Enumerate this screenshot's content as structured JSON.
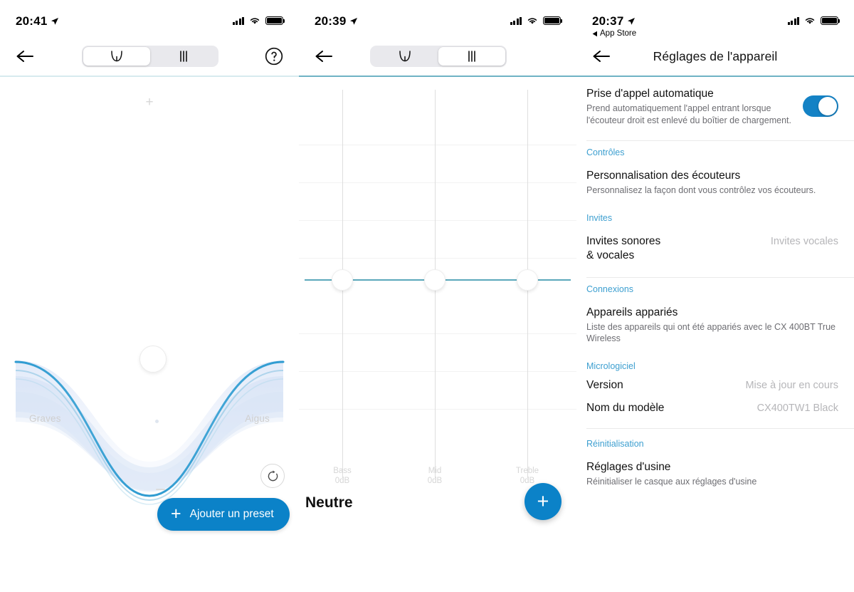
{
  "panel_eq_curve": {
    "status": {
      "time": "20:41",
      "location_icon": "location-arrow-icon"
    },
    "nav": {
      "back_icon": "back-arrow-icon",
      "help_icon": "help-question-icon",
      "segments": [
        {
          "id": "curve",
          "icon": "eq-curve-icon",
          "selected": true
        },
        {
          "id": "sliders",
          "icon": "eq-sliders-icon",
          "selected": false
        }
      ]
    },
    "add_hint": "+",
    "labels": {
      "bass": "Graves",
      "treble": "Aigus"
    },
    "reset_icon": "reset-circular-arrow-icon",
    "add_preset_button": {
      "plus": "+",
      "label": "Ajouter un preset"
    }
  },
  "panel_eq_sliders": {
    "status": {
      "time": "20:39",
      "location_icon": "location-arrow-icon"
    },
    "nav": {
      "back_icon": "back-arrow-icon",
      "segments": [
        {
          "id": "curve",
          "icon": "eq-curve-icon",
          "selected": false
        },
        {
          "id": "sliders",
          "icon": "eq-sliders-icon",
          "selected": true
        }
      ]
    },
    "preset_name": "Neutre",
    "fab_label": "+",
    "sliders": [
      {
        "name": "Bass",
        "value": "0dB"
      },
      {
        "name": "Mid",
        "value": "0dB"
      },
      {
        "name": "Treble",
        "value": "0dB"
      }
    ]
  },
  "panel_device_settings": {
    "status": {
      "time": "20:37",
      "location_icon": "location-arrow-icon",
      "back_app": "App Store",
      "back_app_icon": "back-triangle-icon"
    },
    "nav": {
      "back_icon": "back-arrow-icon",
      "title": "Réglages de l'appareil"
    },
    "rows": [
      {
        "kind": "toggle-row",
        "title": "Prise d'appel automatique",
        "subtitle": "Prend automatiquement l'appel entrant lorsque l'écouteur droit est enlevé du boîtier de chargement.",
        "toggle_on": true
      },
      {
        "kind": "divider"
      },
      {
        "kind": "group",
        "title": "Contrôles"
      },
      {
        "kind": "row",
        "title": "Personnalisation des écouteurs",
        "subtitle": "Personnalisez la façon dont vous contrôlez vos écouteurs."
      },
      {
        "kind": "group",
        "title": "Invites"
      },
      {
        "kind": "row",
        "title": "Invites sonores\n& vocales",
        "value": "Invites vocales"
      },
      {
        "kind": "divider"
      },
      {
        "kind": "group",
        "title": "Connexions"
      },
      {
        "kind": "row",
        "title": "Appareils appariés",
        "subtitle": "Liste des appareils qui ont été appariés avec le CX 400BT True Wireless"
      },
      {
        "kind": "group",
        "title": "Micrologiciel"
      },
      {
        "kind": "row",
        "title": "Version",
        "value": "Mise à jour en cours"
      },
      {
        "kind": "row",
        "title": "Nom du modèle",
        "value": "CX400TW1 Black"
      },
      {
        "kind": "divider"
      },
      {
        "kind": "group",
        "title": "Réinitialisation"
      },
      {
        "kind": "row",
        "title": "Réglages d'usine",
        "subtitle": "Réinitialiser le casque aux réglages d'usine"
      }
    ],
    "group_titles": {
      "controls": "Contrôles",
      "prompts": "Invites",
      "connections": "Connexions",
      "firmware": "Micrologiciel",
      "reset": "Réinitialisation"
    },
    "items": {
      "auto_call_title": "Prise d'appel automatique",
      "auto_call_sub": "Prend automatiquement l'appel entrant lorsque l'écouteur droit est enlevé du boîtier de chargement.",
      "customization_title": "Personnalisation des écouteurs",
      "customization_sub": "Personnalisez la façon dont vous contrôlez vos écouteurs.",
      "prompts_title": "Invites sonores & vocales",
      "prompts_value": "Invites vocales",
      "paired_title": "Appareils appariés",
      "paired_sub": "Liste des appareils qui ont été appariés avec le CX 400BT True Wireless",
      "version_title": "Version",
      "version_value": "Mise à jour en cours",
      "model_title": "Nom du modèle",
      "model_value": "CX400TW1 Black",
      "factory_title": "Réglages d'usine",
      "factory_sub": "Réinitialiser le casque aux réglages d'usine"
    }
  },
  "colors": {
    "accent_blue": "#0b82c8",
    "toggle_blue": "#1482c5",
    "group_heading_blue": "#3d9fd0",
    "teal_rule": "#6fb3c4",
    "zero_line": "#5aa8bb",
    "curve_blue": "#2e9bd1"
  }
}
